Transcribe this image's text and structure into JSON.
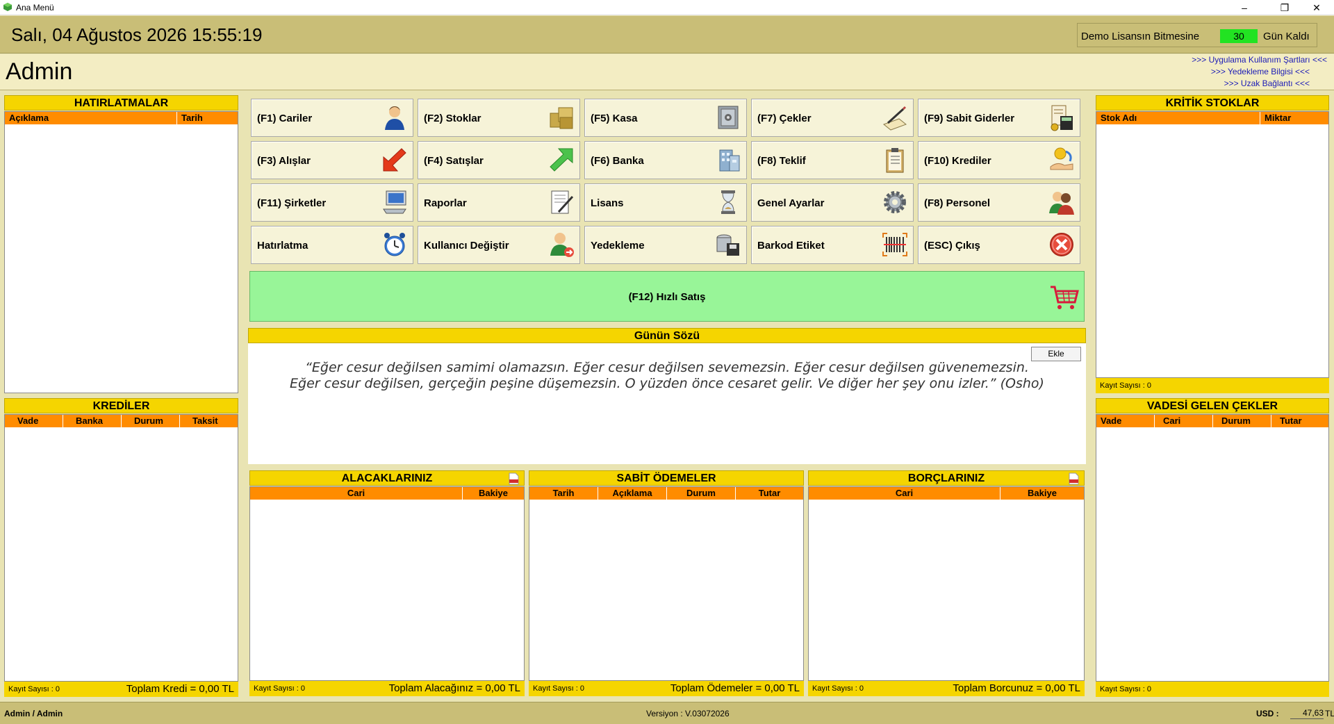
{
  "window": {
    "title": "Ana Menü",
    "controls": {
      "minimize": "–",
      "maximize": "❐",
      "close": "✕"
    }
  },
  "header": {
    "datetime": "Salı, 04 Ağustos 2026 15:55:19",
    "license_label": "Demo Lisansın Bitmesine",
    "license_days": "30",
    "license_suffix": "Gün Kaldı"
  },
  "user": {
    "name": "Admin"
  },
  "links": [
    ">>> Uygulama Kullanım Şartları <<<",
    ">>> Yedekleme Bilgisi <<<",
    ">>> Uzak Bağlantı <<<"
  ],
  "reminders": {
    "title": "HATIRLATMALAR",
    "columns": [
      "Açıklama",
      "Tarih"
    ]
  },
  "credits": {
    "title": "KREDİLER",
    "columns": [
      "Vade",
      "Banka",
      "Durum",
      "Taksit"
    ],
    "count": "Kayıt Sayısı : 0",
    "total": "Toplam Kredi = 0,00 TL"
  },
  "critical_stocks": {
    "title": "KRİTİK STOKLAR",
    "columns": [
      "Stok Adı",
      "Miktar"
    ],
    "count": "Kayıt Sayısı : 0"
  },
  "due_checks": {
    "title": "VADESİ GELEN ÇEKLER",
    "columns": [
      "Vade",
      "Cari",
      "Durum",
      "Tutar"
    ],
    "count": "Kayıt Sayısı : 0"
  },
  "menu": [
    {
      "label": "(F1) Cariler",
      "icon": "user-icon"
    },
    {
      "label": "(F2) Stoklar",
      "icon": "boxes-icon"
    },
    {
      "label": "(F5) Kasa",
      "icon": "safe-icon"
    },
    {
      "label": "(F7) Çekler",
      "icon": "check-sign-icon"
    },
    {
      "label": "(F9) Sabit Giderler",
      "icon": "invoice-calculator-icon"
    },
    {
      "label": "(F3) Alışlar",
      "icon": "arrow-down-left-icon"
    },
    {
      "label": "(F4) Satışlar",
      "icon": "arrow-up-right-icon"
    },
    {
      "label": "(F6) Banka",
      "icon": "bank-building-icon"
    },
    {
      "label": "(F8) Teklif",
      "icon": "clipboard-icon"
    },
    {
      "label": "(F10) Krediler",
      "icon": "coin-hand-icon"
    },
    {
      "label": "(F11) Şirketler",
      "icon": "computer-icon"
    },
    {
      "label": "Raporlar",
      "icon": "report-icon"
    },
    {
      "label": "Lisans",
      "icon": "hourglass-icon"
    },
    {
      "label": "Genel Ayarlar",
      "icon": "gear-icon"
    },
    {
      "label": "(F8) Personel",
      "icon": "staff-icon"
    },
    {
      "label": "Hatırlatma",
      "icon": "alarm-clock-icon"
    },
    {
      "label": "Kullanıcı Değiştir",
      "icon": "switch-user-icon"
    },
    {
      "label": "Yedekleme",
      "icon": "backup-disk-icon"
    },
    {
      "label": "Barkod Etiket",
      "icon": "barcode-icon"
    },
    {
      "label": "(ESC) Çıkış",
      "icon": "exit-icon"
    }
  ],
  "quick_sale": {
    "label": "(F12) Hızlı Satış",
    "icon": "shopping-cart-icon"
  },
  "quote": {
    "title": "Günün Sözü",
    "button": "Ekle",
    "text": "“Eğer cesur değilsen samimi olamazsın. Eğer cesur değilsen sevemezsin. Eğer cesur değilsen güvenemezsin. Eğer cesur değilsen, gerçeğin peşine düşemezsin. O yüzden önce cesaret gelir. Ve diğer her şey onu izler.” (Osho)"
  },
  "receivables": {
    "title": "ALACAKLARINIZ",
    "columns": [
      "Cari",
      "Bakiye"
    ],
    "count": "Kayıt Sayısı : 0",
    "total": "Toplam Alacağınız = 0,00 TL"
  },
  "fixed_payments": {
    "title": "SABİT ÖDEMELER",
    "columns": [
      "Tarih",
      "Açıklama",
      "Durum",
      "Tutar"
    ],
    "count": "Kayıt Sayısı : 0",
    "total": "Toplam Ödemeler = 0,00 TL"
  },
  "debts": {
    "title": "BORÇLARINIZ",
    "columns": [
      "Cari",
      "Bakiye"
    ],
    "count": "Kayıt Sayısı : 0",
    "total": "Toplam Borcunuz = 0,00 TL"
  },
  "status": {
    "user": "Admin / Admin",
    "version": "Versiyon :    V.03072026",
    "usd_label": "USD :",
    "usd_value": "47,63",
    "currency": "TL"
  }
}
